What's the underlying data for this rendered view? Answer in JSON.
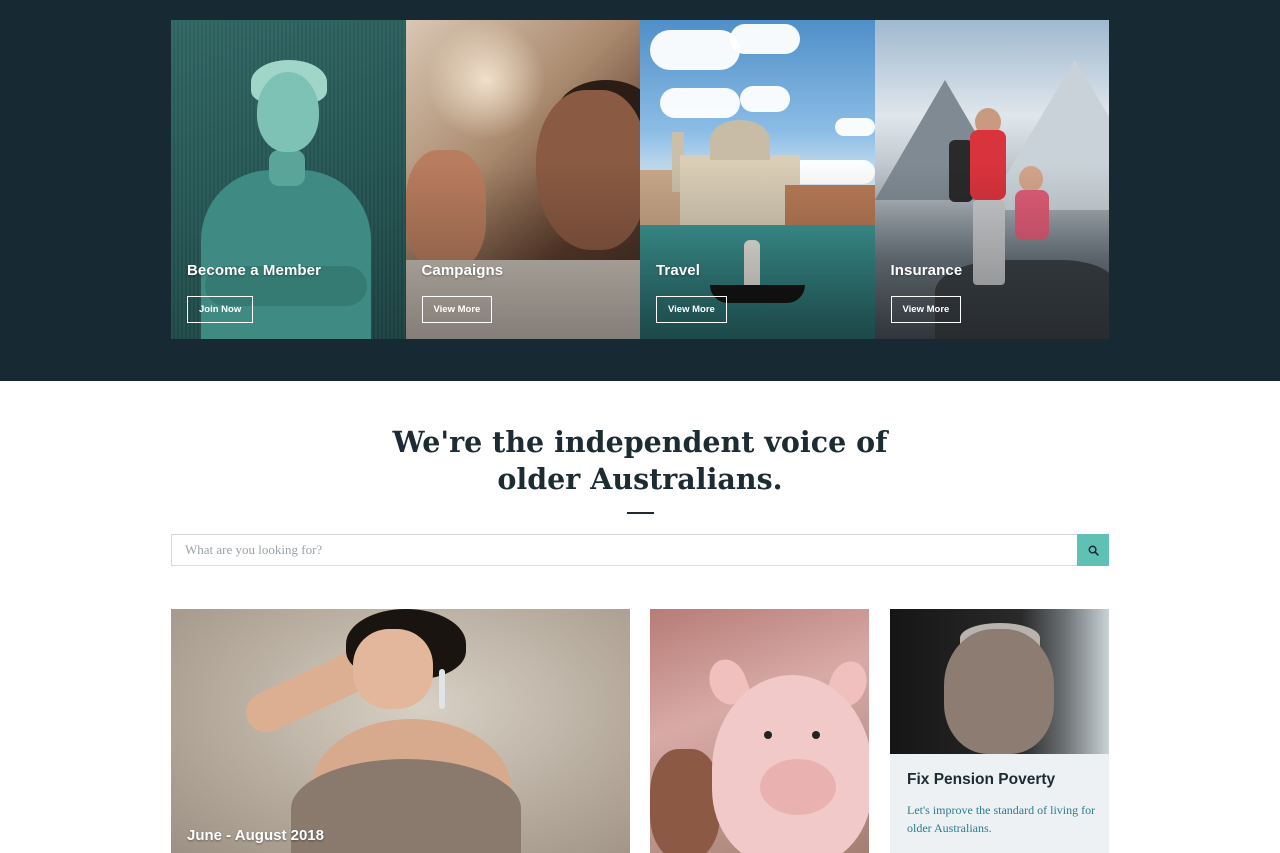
{
  "hero": {
    "tiles": [
      {
        "title": "Become a Member",
        "button": "Join Now"
      },
      {
        "title": "Campaigns",
        "button": "View More"
      },
      {
        "title": "Travel",
        "button": "View More"
      },
      {
        "title": "Insurance",
        "button": "View More"
      }
    ]
  },
  "tagline": {
    "line1": "We're the independent voice of",
    "line2": "older Australians."
  },
  "search": {
    "placeholder": "What are you looking for?",
    "button_icon": "search-icon",
    "button_color": "#5ec1b4"
  },
  "cards": {
    "feature": {
      "caption": "June - August 2018"
    },
    "savings": {
      "image": "piggy-bank"
    },
    "pension": {
      "title": "Fix Pension Poverty",
      "text": "Let's improve the standard of living for older Australians."
    }
  },
  "colors": {
    "hero_bg": "#172a34",
    "accent": "#5ec1b4",
    "link_text": "#2a7d8e"
  }
}
